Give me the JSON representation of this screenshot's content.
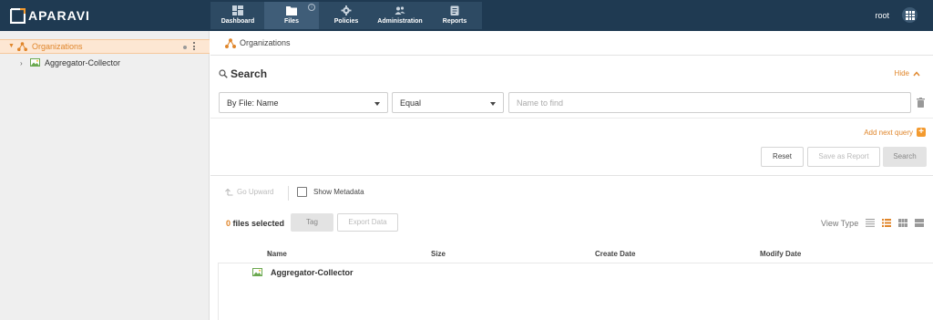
{
  "app": {
    "brand": "APARAVI",
    "user": "root",
    "colors": {
      "topbar": "#1f3a52",
      "accent": "#e0862b",
      "sidebar": "#efefef",
      "selected_row": "#fde7d3"
    }
  },
  "nav": {
    "tabs": [
      {
        "label": "Dashboard",
        "icon": "dashboard-icon",
        "active": false
      },
      {
        "label": "Files",
        "icon": "folder-icon",
        "active": true,
        "info_badge": "i"
      },
      {
        "label": "Policies",
        "icon": "gear-icon",
        "active": false
      },
      {
        "label": "Administration",
        "icon": "users-icon",
        "active": false
      },
      {
        "label": "Reports",
        "icon": "clipboard-icon",
        "active": false
      }
    ]
  },
  "sidebar": {
    "root": {
      "label": "Organizations",
      "icon": "organization-icon",
      "expanded": true
    },
    "children": [
      {
        "label": "Aggregator-Collector",
        "icon": "image-icon",
        "expanded": false
      }
    ]
  },
  "breadcrumb": {
    "label": "Organizations",
    "icon": "organization-icon"
  },
  "search": {
    "title": "Search",
    "hide_label": "Hide",
    "field_select": "By File: Name",
    "operator_select": "Equal",
    "value": "",
    "placeholder": "Name to find",
    "add_query_label": "Add next query",
    "add_query_icon": "+",
    "buttons": {
      "reset": "Reset",
      "save_report": "Save as Report",
      "search": "Search"
    }
  },
  "toolbar": {
    "go_upward": "Go Upward",
    "show_metadata": "Show Metadata"
  },
  "files": {
    "count": "0",
    "count_suffix": " files selected",
    "tag_label": "Tag",
    "export_label": "Export Data",
    "view_type_label": "View Type",
    "active_view": "list"
  },
  "grid": {
    "columns": {
      "name": "Name",
      "sort_arrow": "↑",
      "size": "Size",
      "create_date": "Create Date",
      "modify_date": "Modify Date"
    },
    "rows": [
      {
        "name": "Aggregator-Collector",
        "icon": "image-icon",
        "size": "",
        "create_date": "",
        "modify_date": ""
      }
    ]
  }
}
